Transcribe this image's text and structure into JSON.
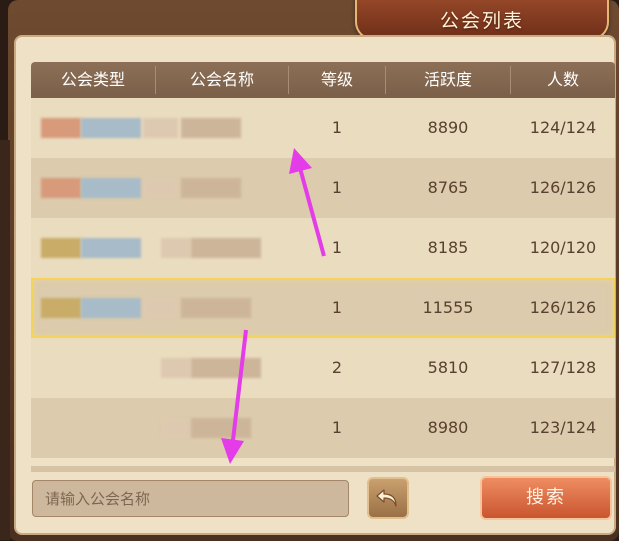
{
  "window": {
    "title": "公会列表"
  },
  "table": {
    "headers": [
      "公会类型",
      "公会名称",
      "等级",
      "活跃度",
      "人数"
    ],
    "rows": [
      {
        "level": "1",
        "activity": "8890",
        "members": "124/124",
        "selected": false
      },
      {
        "level": "1",
        "activity": "8765",
        "members": "126/126",
        "selected": false
      },
      {
        "level": "1",
        "activity": "8185",
        "members": "120/120",
        "selected": false
      },
      {
        "level": "1",
        "activity": "11555",
        "members": "126/126",
        "selected": true
      },
      {
        "level": "2",
        "activity": "5810",
        "members": "127/128",
        "selected": false
      },
      {
        "level": "1",
        "activity": "8980",
        "members": "123/124",
        "selected": false
      }
    ]
  },
  "search": {
    "placeholder": "请输入公会名称",
    "value": "",
    "button_label": "搜索"
  },
  "icons": {
    "back": "undo-arrow-icon"
  },
  "colors": {
    "accent": "#d1603a",
    "header": "#7f634c",
    "selected_outline": "#f3d35c",
    "annotation_arrow": "#e33ce8"
  }
}
